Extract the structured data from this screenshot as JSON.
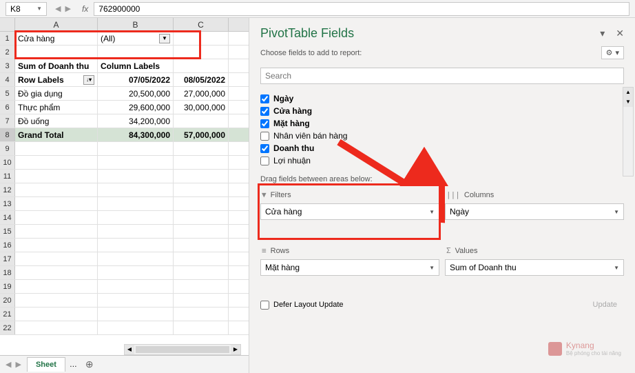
{
  "namebox": "K8",
  "formula": "762900000",
  "columns": [
    "A",
    "B",
    "C"
  ],
  "pivot": {
    "filter_field": "Cửa hàng",
    "filter_value": "(All)",
    "data_field": "Sum of Doanh thu",
    "column_field": "Column Labels",
    "row_field": "Row Labels",
    "col_dates": [
      "07/05/2022",
      "08/05/2022"
    ],
    "rows": [
      {
        "label": "Đồ gia dụng",
        "vals": [
          "20,500,000",
          "27,000,000"
        ]
      },
      {
        "label": "Thực phẩm",
        "vals": [
          "29,600,000",
          "30,000,000"
        ]
      },
      {
        "label": "Đồ uống",
        "vals": [
          "34,200,000",
          ""
        ]
      }
    ],
    "total_label": "Grand Total",
    "totals": [
      "84,300,000",
      "57,000,000"
    ]
  },
  "sheet_tab": "Sheet",
  "pane": {
    "title": "PivotTable Fields",
    "subtitle": "Choose fields to add to report:",
    "search_placeholder": "Search",
    "fields": [
      {
        "label": "Ngày",
        "checked": true
      },
      {
        "label": "Cửa hàng",
        "checked": true
      },
      {
        "label": "Mặt hàng",
        "checked": true
      },
      {
        "label": "Nhân viên bán hàng",
        "checked": false
      },
      {
        "label": "Doanh thu",
        "checked": true
      },
      {
        "label": "Lợi nhuận",
        "checked": false
      }
    ],
    "drag_label": "Drag fields between areas below:",
    "areas": {
      "filters": {
        "title": "Filters",
        "value": "Cửa hàng"
      },
      "columns": {
        "title": "Columns",
        "value": "Ngày"
      },
      "rows": {
        "title": "Rows",
        "value": "Mặt hàng"
      },
      "values": {
        "title": "Values",
        "value": "Sum of Doanh thu"
      }
    },
    "defer": "Defer Layout Update",
    "update": "Update"
  },
  "watermark": {
    "brand": "Kynang",
    "sub": "Bệ phóng cho tài năng"
  }
}
